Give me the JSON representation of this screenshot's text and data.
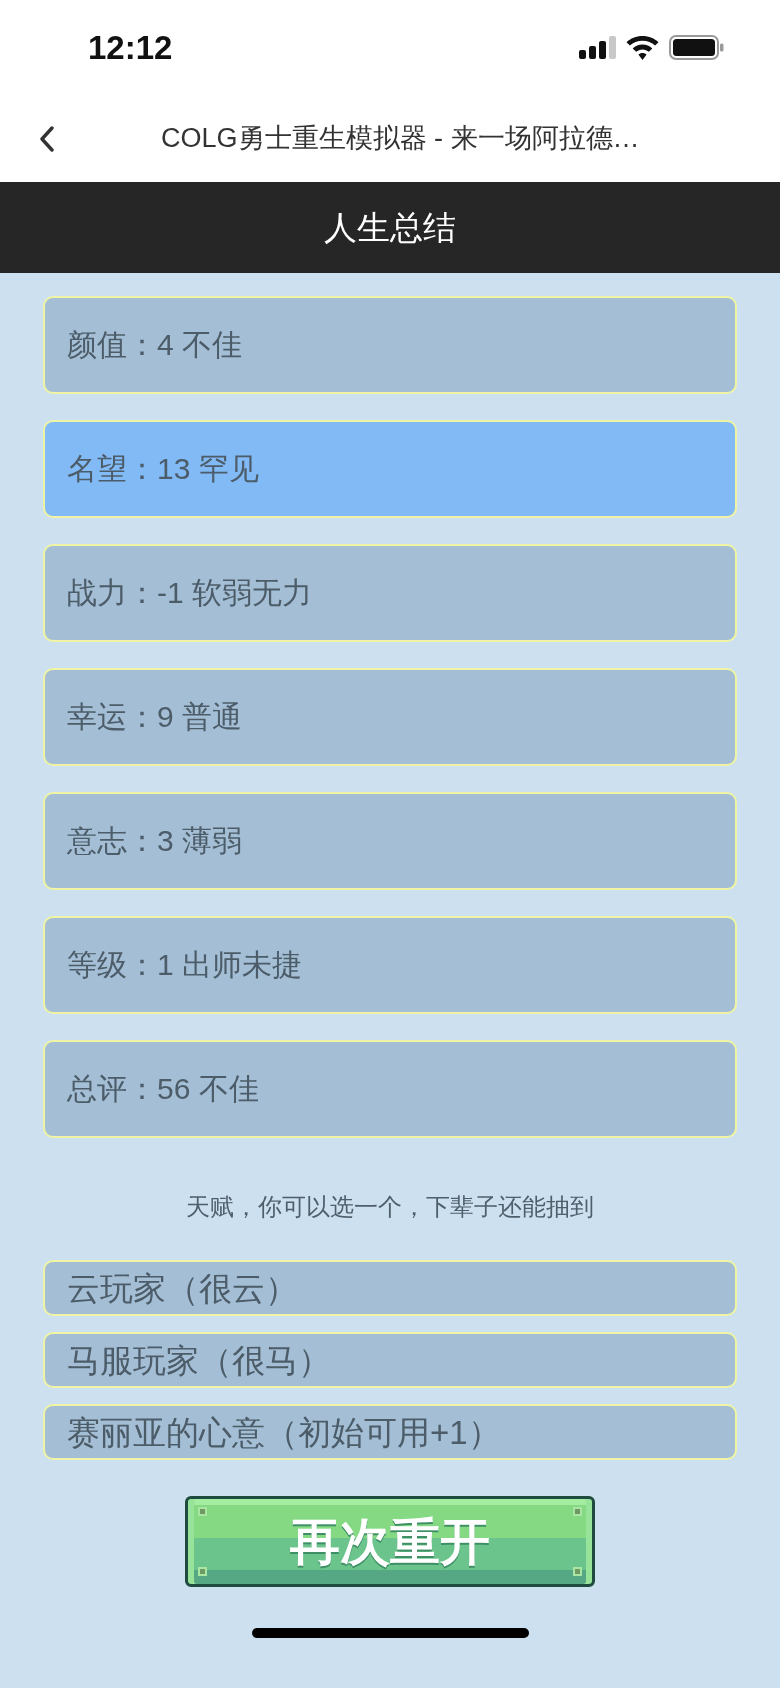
{
  "status_bar": {
    "time": "12:12"
  },
  "nav": {
    "title": "COLG勇士重生模拟器 - 来一场阿拉德…"
  },
  "header": {
    "title": "人生总结"
  },
  "stats": [
    {
      "text": "颜值：4 不佳",
      "color": "#a4bfd5"
    },
    {
      "text": "名望：13 罕见",
      "color": "#82baf6"
    },
    {
      "text": "战力：-1 软弱无力",
      "color": "#a4bfd5"
    },
    {
      "text": "幸运：9 普通",
      "color": "#a4bfd5"
    },
    {
      "text": "意志：3 薄弱",
      "color": "#a4bfd5"
    },
    {
      "text": "等级：1 出师未捷",
      "color": "#a4bfd5"
    },
    {
      "text": "总评：56 不佳",
      "color": "#a4bfd5"
    }
  ],
  "talent_hint": "天赋，你可以选一个，下辈子还能抽到",
  "talents": [
    {
      "label": "云玩家（很云）",
      "selected": false
    },
    {
      "label": "马服玩家（很马）",
      "selected": false
    },
    {
      "label": "赛丽亚的心意（初始可用+1）",
      "selected": false
    }
  ],
  "restart_button": {
    "label": "再次重开"
  }
}
